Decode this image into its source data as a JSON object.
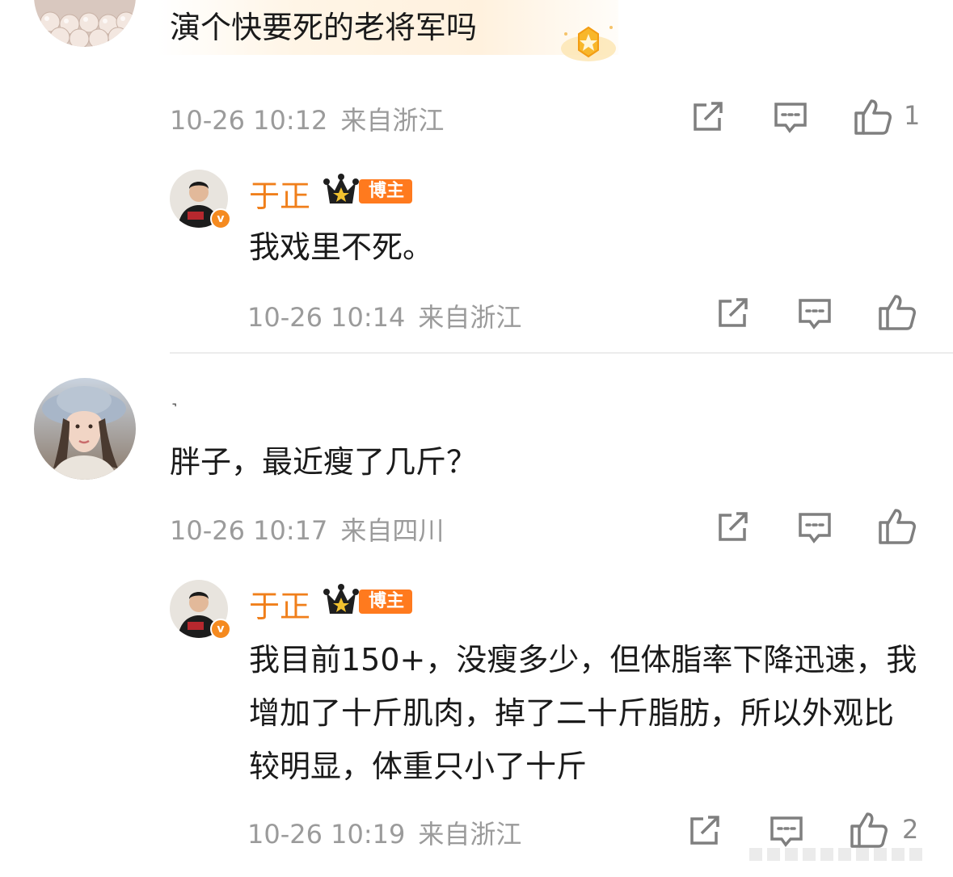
{
  "comments": [
    {
      "text": "演个快要死的老将军吗",
      "time": "10-26 10:12",
      "location": "来自浙江",
      "likes": "1",
      "reply": {
        "username": "于正",
        "badge": "博主",
        "text": "我戏里不死。",
        "time": "10-26 10:14",
        "location": "来自浙江"
      }
    },
    {
      "username_glyph": "˺",
      "text": "胖子，最近瘦了几斤？",
      "time": "10-26 10:17",
      "location": "来自四川",
      "reply": {
        "username": "于正",
        "badge": "博主",
        "text": "我目前150+，没瘦多少，但体脂率下降迅速，我增加了十斤肌肉，掉了二十斤脂肪，所以外观比较明显，体重只小了十斤",
        "time": "10-26 10:19",
        "location": "来自浙江",
        "likes": "2"
      }
    }
  ],
  "verify_mark": "v",
  "colors": {
    "username": "#f07f1b",
    "badge_bg": "#ff7a1e",
    "meta": "#9b9b9b",
    "icon": "#7f7f7f"
  },
  "icons": [
    "share-icon",
    "comment-icon",
    "like-icon",
    "crown-icon",
    "star-badge-icon"
  ]
}
